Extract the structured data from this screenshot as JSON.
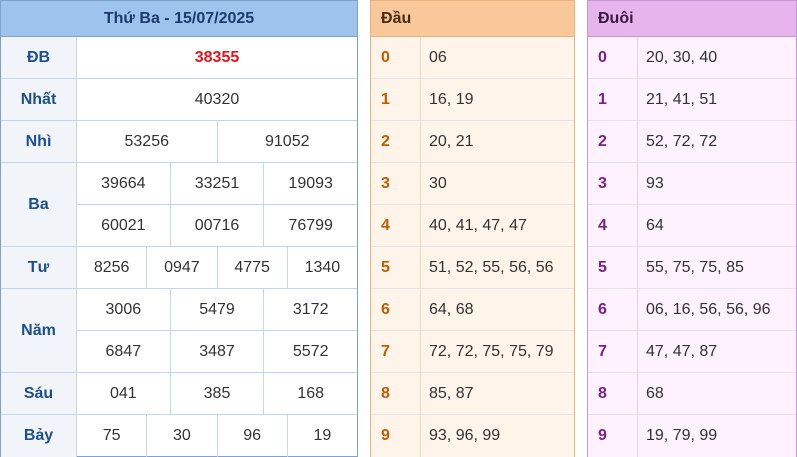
{
  "results": {
    "date_title": "Thứ Ba - 15/07/2025",
    "prizes": [
      {
        "label": "ĐB",
        "rows": [
          [
            "38355"
          ]
        ],
        "special": true
      },
      {
        "label": "Nhất",
        "rows": [
          [
            "40320"
          ]
        ]
      },
      {
        "label": "Nhì",
        "rows": [
          [
            "53256",
            "91052"
          ]
        ]
      },
      {
        "label": "Ba",
        "rows": [
          [
            "39664",
            "33251",
            "19093"
          ],
          [
            "60021",
            "00716",
            "76799"
          ]
        ]
      },
      {
        "label": "Tư",
        "rows": [
          [
            "8256",
            "0947",
            "4775",
            "1340"
          ]
        ]
      },
      {
        "label": "Năm",
        "rows": [
          [
            "3006",
            "5479",
            "3172"
          ],
          [
            "6847",
            "3487",
            "5572"
          ]
        ]
      },
      {
        "label": "Sáu",
        "rows": [
          [
            "041",
            "385",
            "168"
          ]
        ]
      },
      {
        "label": "Bảy",
        "rows": [
          [
            "75",
            "30",
            "96",
            "19"
          ]
        ]
      }
    ]
  },
  "dau": {
    "header": "Đầu",
    "rows": [
      {
        "key": "0",
        "values": "06"
      },
      {
        "key": "1",
        "values": "16, 19"
      },
      {
        "key": "2",
        "values": "20, 21"
      },
      {
        "key": "3",
        "values": "30"
      },
      {
        "key": "4",
        "values": "40, 41, 47, 47"
      },
      {
        "key": "5",
        "values": "51, 52, 55, 56, 56"
      },
      {
        "key": "6",
        "values": "64, 68"
      },
      {
        "key": "7",
        "values": "72, 72, 75, 75, 79"
      },
      {
        "key": "8",
        "values": "85, 87"
      },
      {
        "key": "9",
        "values": "93, 96, 99"
      }
    ]
  },
  "duoi": {
    "header": "Đuôi",
    "rows": [
      {
        "key": "0",
        "values": "20, 30, 40"
      },
      {
        "key": "1",
        "values": "21, 41, 51"
      },
      {
        "key": "2",
        "values": "52, 72, 72"
      },
      {
        "key": "3",
        "values": "93"
      },
      {
        "key": "4",
        "values": "64"
      },
      {
        "key": "5",
        "values": "55, 75, 75, 85"
      },
      {
        "key": "6",
        "values": "06, 16, 56, 56, 96"
      },
      {
        "key": "7",
        "values": "47, 47, 87"
      },
      {
        "key": "8",
        "values": "68"
      },
      {
        "key": "9",
        "values": "19, 79, 99"
      }
    ]
  },
  "colors": {
    "special_prize": "#e3141b",
    "results_header": "#9ec3ec",
    "dau_header": "#f8c89a",
    "duoi_header": "#e7b4ee"
  }
}
